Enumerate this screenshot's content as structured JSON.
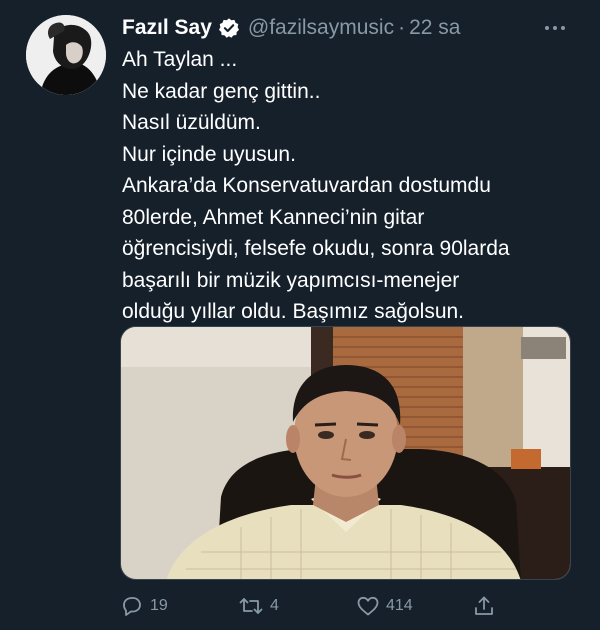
{
  "tweet": {
    "author": {
      "display_name": "Fazıl Say",
      "handle": "@fazilsaymusic",
      "verified": true
    },
    "separator": "·",
    "time": "22 sa",
    "lines": [
      "Ah Taylan ...",
      "Ne kadar genç gittin..",
      "Nasıl üzüldüm.",
      "Nur içinde uyusun.",
      "Ankara’da Konservatuvardan dostumdu",
      "80lerde, Ahmet Kanneci’nin gitar",
      "öğrencisiydi, felsefe okudu, sonra 90larda",
      "başarılı bir müzik yapımcısı-menejer",
      "olduğu yıllar oldu. Başımız sağolsun."
    ],
    "actions": {
      "replies": "19",
      "retweets": "4",
      "likes": "414"
    }
  },
  "icons": {
    "more": "more-horizontal-icon",
    "verified": "verified-badge-icon",
    "reply": "reply-icon",
    "retweet": "retweet-icon",
    "like": "heart-icon",
    "share": "share-icon"
  },
  "colors": {
    "background": "#15202b",
    "text": "#ffffff",
    "secondary_text": "#8899a6",
    "verified_badge": "#ffffff"
  }
}
